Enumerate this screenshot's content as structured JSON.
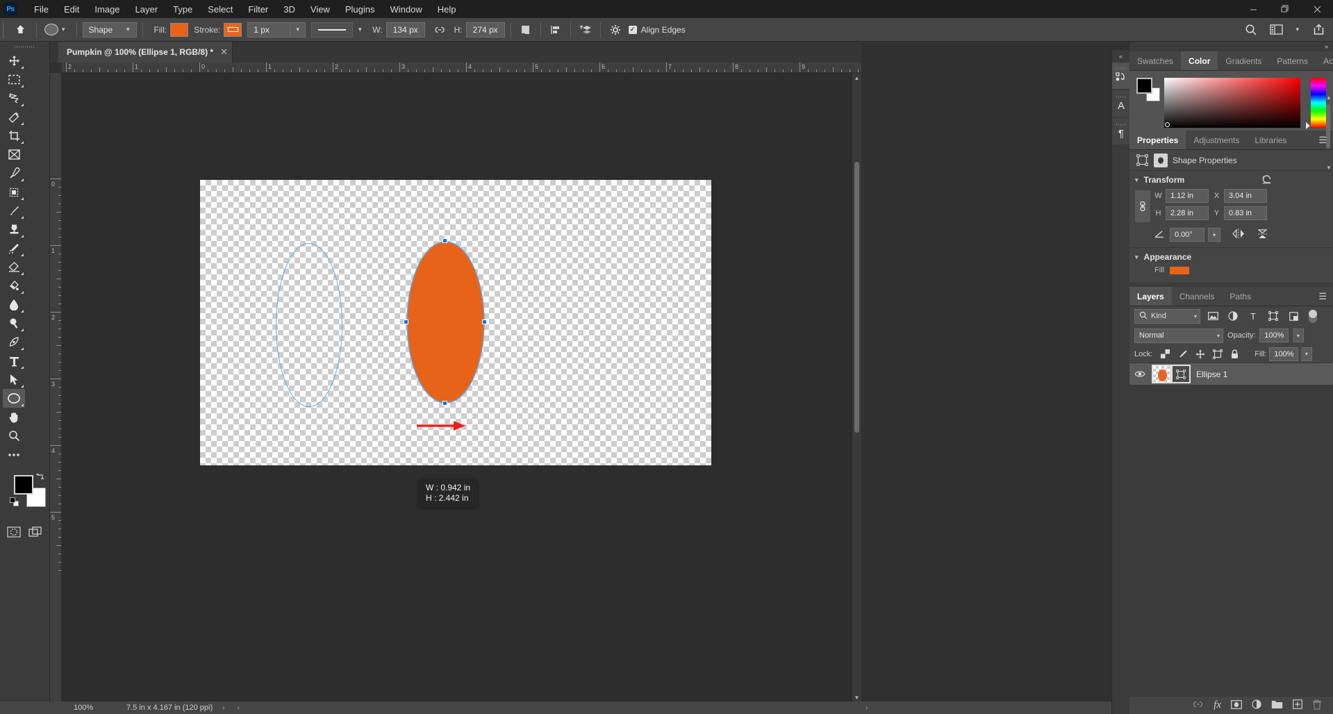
{
  "app": {
    "name": "Ps",
    "logo_color": "#31a8ff"
  },
  "menubar": {
    "items": [
      "File",
      "Edit",
      "Image",
      "Layer",
      "Type",
      "Select",
      "Filter",
      "3D",
      "View",
      "Plugins",
      "Window",
      "Help"
    ],
    "window_controls": {
      "minimize": "—",
      "maximize": "❐",
      "close": "✕"
    }
  },
  "options_bar": {
    "home_icon": "home-icon",
    "tool_preset_icon": "ellipse-tool-preview",
    "mode_select": "Shape",
    "fill_label": "Fill:",
    "fill_color": "#e8631a",
    "stroke_label": "Stroke:",
    "stroke_color": "#e8631a",
    "stroke_width": "1 px",
    "stroke_style_icon": "solid-line",
    "w_label": "W:",
    "w_value": "134 px",
    "link_icon": "link-icon",
    "h_label": "H:",
    "h_value": "274 px",
    "path_ops_icon": "path-operations-icon",
    "path_align_icon": "path-alignment-icon",
    "path_arrange_icon": "path-arrangement-icon",
    "settings_icon": "gear-icon",
    "align_edges_label": "Align Edges",
    "align_edges_checked": true,
    "search_icon": "search-icon",
    "workspace_icon": "workspace-icon",
    "share_icon": "share-icon"
  },
  "toolbar": {
    "tools": [
      {
        "name": "move-tool",
        "glyph": "✥",
        "sub": true,
        "selected": false
      },
      {
        "name": "rectangular-marquee-tool",
        "glyph": "⬚",
        "sub": true,
        "selected": false
      },
      {
        "name": "lasso-tool",
        "glyph": "➦",
        "sub": true,
        "selected": false
      },
      {
        "name": "object-selection-tool",
        "glyph": "✨",
        "sub": true,
        "selected": false
      },
      {
        "name": "crop-tool",
        "glyph": "⌗",
        "sub": true,
        "selected": false
      },
      {
        "name": "frame-tool",
        "glyph": "⌧",
        "sub": false,
        "selected": false
      },
      {
        "name": "eyedropper-tool",
        "glyph": "✒",
        "sub": true,
        "selected": false
      },
      {
        "name": "spot-healing-brush-tool",
        "glyph": "⬛",
        "sub": true,
        "selected": false
      },
      {
        "name": "brush-tool",
        "glyph": "✎",
        "sub": true,
        "selected": false
      },
      {
        "name": "clone-stamp-tool",
        "glyph": "⚑",
        "sub": true,
        "selected": false
      },
      {
        "name": "history-brush-tool",
        "glyph": "✐",
        "sub": true,
        "selected": false
      },
      {
        "name": "eraser-tool",
        "glyph": "◱",
        "sub": true,
        "selected": false
      },
      {
        "name": "gradient-tool",
        "glyph": "◢",
        "sub": true,
        "selected": false
      },
      {
        "name": "blur-tool",
        "glyph": "●",
        "sub": true,
        "selected": false
      },
      {
        "name": "dodge-tool",
        "glyph": "⚲",
        "sub": true,
        "selected": false
      },
      {
        "name": "pen-tool",
        "glyph": "✒",
        "sub": true,
        "selected": false
      },
      {
        "name": "horizontal-type-tool",
        "glyph": "T",
        "sub": true,
        "selected": false
      },
      {
        "name": "path-selection-tool",
        "glyph": "➤",
        "sub": true,
        "selected": false
      },
      {
        "name": "ellipse-tool",
        "glyph": "◯",
        "sub": true,
        "selected": true
      },
      {
        "name": "hand-tool",
        "glyph": "✋",
        "sub": false,
        "selected": false
      },
      {
        "name": "zoom-tool",
        "glyph": "⚲",
        "sub": false,
        "selected": false
      },
      {
        "name": "edit-toolbar-tool",
        "glyph": "⋯",
        "sub": false,
        "selected": false
      }
    ],
    "foreground_color": "#000000",
    "background_color": "#ffffff",
    "swap_icon": "swap-colors-icon",
    "default_colors_icon": "default-colors-icon",
    "quick_mask_icon": "quick-mask-icon",
    "screen_mode_icon": "screen-mode-icon"
  },
  "document": {
    "tab_title": "Pumpkin @ 100% (Ellipse 1, RGB/8) *",
    "close_icon": "close-icon"
  },
  "rulers": {
    "horizontal_labels": [
      "2",
      "1",
      "0",
      "1",
      "2",
      "3",
      "4",
      "5",
      "6",
      "7",
      "8",
      "9"
    ],
    "vertical_labels": [
      "0",
      "1",
      "2",
      "3",
      "4",
      "5"
    ],
    "unit": "in"
  },
  "canvas": {
    "ghost_ellipse_stroke": "#5fa8e8",
    "orange_ellipse_fill": "#e8631a",
    "orange_ellipse_stroke": "#5fa8e8",
    "arrow_color": "#ee1c16",
    "arrow_name": "red-annotation-arrow",
    "selection_handle_color": "#1473e6",
    "tooltip": {
      "w_line": "W : 0.942 in",
      "h_line": "H : 2.442 in"
    }
  },
  "statusbar": {
    "zoom": "100%",
    "doc_size": "7.5 in x 4.167 in (120 ppi)",
    "expand_icon": "›",
    "prev_icon": "‹",
    "next_icon": "›"
  },
  "rail": {
    "collapse_icon": "«",
    "items": [
      {
        "name": "history-panel-icon",
        "glyph": "⥁",
        "active": true
      },
      {
        "name": "character-panel-icon",
        "glyph": "A",
        "active": false
      },
      {
        "name": "paragraph-panel-icon",
        "glyph": "¶",
        "active": false
      }
    ]
  },
  "right_panels": {
    "collapse_icon": "»",
    "color_group": {
      "tabs": [
        {
          "label": "Swatches",
          "active": false
        },
        {
          "label": "Color",
          "active": true
        },
        {
          "label": "Gradients",
          "active": false
        },
        {
          "label": "Patterns",
          "active": false
        },
        {
          "label": "Actions",
          "active": false
        }
      ],
      "menu_icon": "panel-menu-icon",
      "foreground": "#000000",
      "background": "#ffffff"
    },
    "properties_group": {
      "tabs": [
        {
          "label": "Properties",
          "active": true
        },
        {
          "label": "Adjustments",
          "active": false
        },
        {
          "label": "Libraries",
          "active": false
        }
      ],
      "menu_icon": "panel-menu-icon",
      "header_title": "Shape Properties",
      "header_icon_1": "transform-bounds-icon",
      "header_icon_2": "shape-mask-icon",
      "transform": {
        "section_label": "Transform",
        "reset_icon": "reset-icon",
        "link_icon": "link-dimensions-icon",
        "w_label": "W",
        "w_value": "1.12 in",
        "h_label": "H",
        "h_value": "2.28 in",
        "x_label": "X",
        "x_value": "3.04 in",
        "y_label": "Y",
        "y_value": "0.83 in",
        "angle_label": "angle-icon",
        "angle_value": "0.00°",
        "flip_h_icon": "flip-horizontal-icon",
        "flip_v_icon": "flip-vertical-icon"
      },
      "appearance": {
        "section_label": "Appearance",
        "fill_label": "Fill",
        "fill_color": "#e8631a"
      }
    },
    "layers_group": {
      "tabs": [
        {
          "label": "Layers",
          "active": true
        },
        {
          "label": "Channels",
          "active": false
        },
        {
          "label": "Paths",
          "active": false
        }
      ],
      "menu_icon": "panel-menu-icon",
      "filter": {
        "search_icon": "search-icon",
        "kind_label": "Kind",
        "filter_icons": [
          "filter-pixel-icon",
          "filter-adjustment-icon",
          "filter-type-icon",
          "filter-shape-icon",
          "filter-smart-object-icon"
        ],
        "toggle_name": "filter-toggle"
      },
      "blend_mode": "Normal",
      "opacity_label": "Opacity:",
      "opacity_value": "100%",
      "lock_label": "Lock:",
      "lock_icons": [
        "lock-transparent-pixels-icon",
        "lock-image-pixels-icon",
        "lock-position-icon",
        "lock-artboard-nesting-icon",
        "lock-all-icon"
      ],
      "fill_label": "Fill:",
      "fill_value": "100%",
      "layers": [
        {
          "name": "Ellipse 1",
          "visible": true,
          "selected": true,
          "thumb_color": "#e8631a",
          "vector_mask_icon": "vector-mask-icon"
        }
      ],
      "footer_icons": [
        "link-layers-icon",
        "layer-style-icon",
        "layer-mask-icon",
        "adjustment-layer-icon",
        "new-group-icon",
        "new-layer-icon",
        "delete-layer-icon"
      ]
    }
  }
}
